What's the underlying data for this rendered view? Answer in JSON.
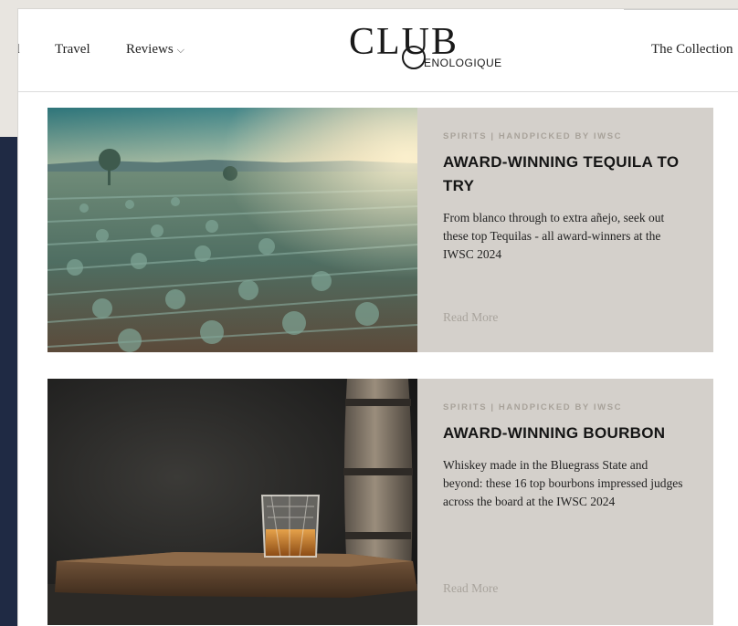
{
  "nav": {
    "cut_item": "d",
    "travel": "Travel",
    "reviews": "Reviews",
    "reviews_chevron": "chevron-down-icon",
    "collection": "The Collection"
  },
  "logo": {
    "main": "CLUB",
    "sub": "ENOLOGIQUE"
  },
  "articles": [
    {
      "kicker": "SPIRITS | HANDPICKED BY IWSC",
      "title": "AWARD-WINNING TEQUILA TO TRY",
      "description": "From blanco through to extra añejo, seek out these top Tequilas - all award-winners at the IWSC 2024",
      "read_more": "Read More",
      "image": "agave-field-photo"
    },
    {
      "kicker": "SPIRITS | HANDPICKED BY IWSC",
      "title": "AWARD-WINNING BOURBON",
      "description": "Whiskey made in the Bluegrass State and beyond: these 16 top bourbons impressed judges across the board at the IWSC 2024",
      "read_more": "Read More",
      "image": "bourbon-glass-barrel-photo"
    }
  ],
  "colors": {
    "card_bg": "#d4d0cb",
    "backdrop": "#1f2a44",
    "kicker": "#a8a29a",
    "read_more": "#a9a49d"
  }
}
